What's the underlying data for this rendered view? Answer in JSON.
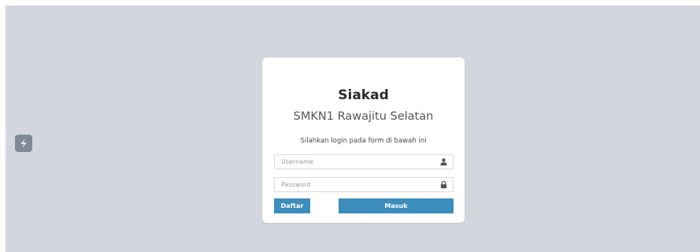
{
  "login": {
    "title": "Siakad",
    "subtitle": "SMKN1 Rawajitu Selatan",
    "hint": "Silahkan login pada form di bawah ini",
    "username": {
      "placeholder": "Username",
      "value": "",
      "icon": "user-icon"
    },
    "password": {
      "placeholder": "Password",
      "value": "",
      "icon": "lock-icon"
    },
    "buttons": {
      "daftar_label": "Daftar",
      "masuk_label": "Masuk"
    }
  },
  "floating_button": {
    "icon": "lightning-logo-icon"
  },
  "colors": {
    "background": "#d2d6de",
    "card": "#ffffff",
    "primary": "#3c8dbc"
  }
}
